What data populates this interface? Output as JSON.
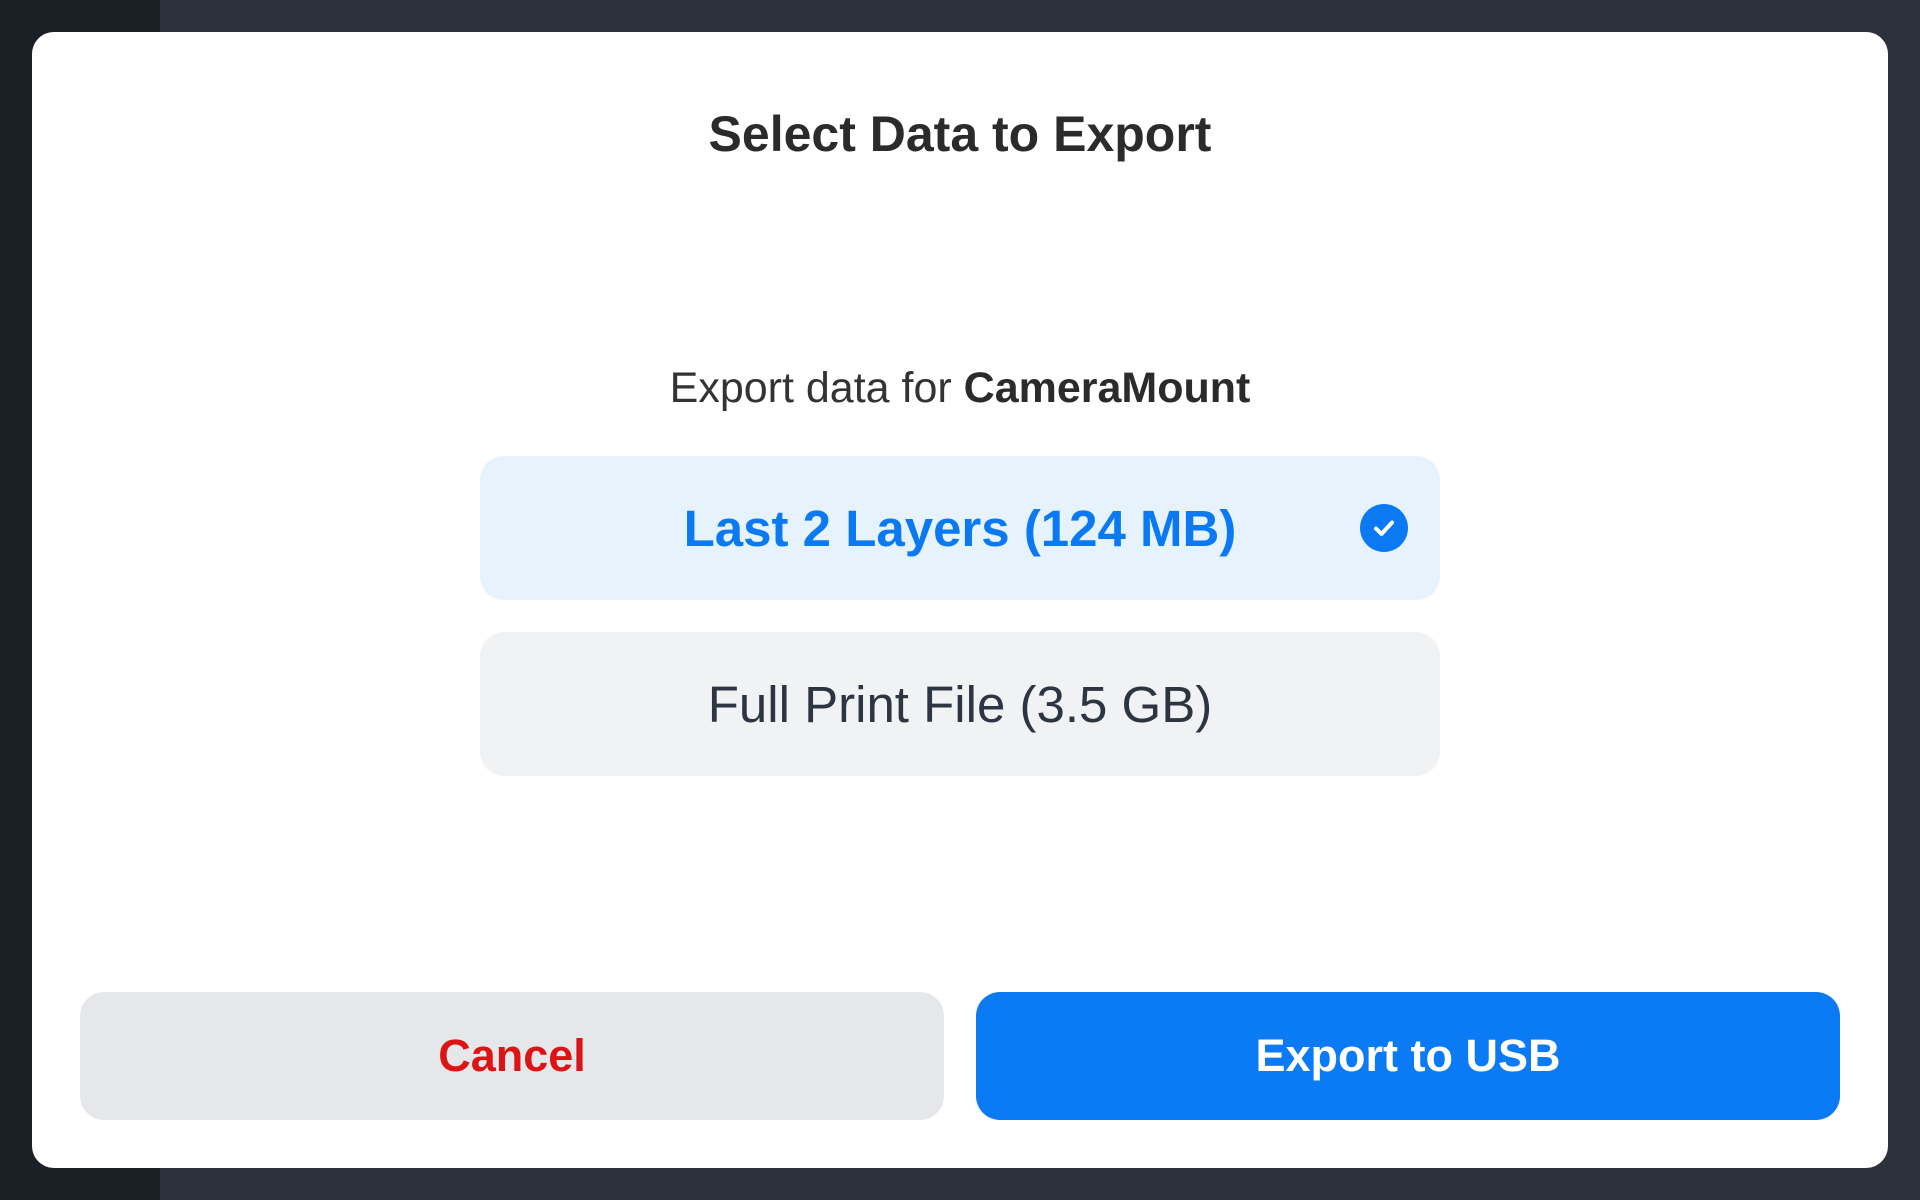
{
  "dialog": {
    "title": "Select Data to Export",
    "subtitle_prefix": "Export data for ",
    "subtitle_target": "CameraMount",
    "options": [
      {
        "label": "Last 2 Layers (124 MB)",
        "selected": true,
        "icon": "check-circle-icon"
      },
      {
        "label": "Full Print File (3.5 GB)",
        "selected": false
      }
    ],
    "cancel_label": "Cancel",
    "export_label": "Export to USB"
  },
  "colors": {
    "accent": "#0a79f2",
    "selected_bg": "#e6f3fd",
    "unselected_bg": "#f1f2f4",
    "cancel_text": "#dc1414",
    "cancel_bg": "#e6e7ea"
  }
}
